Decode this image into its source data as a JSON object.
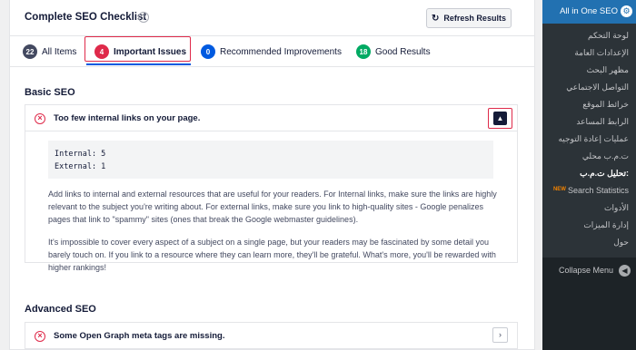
{
  "header": {
    "title": "Complete SEO Checklist",
    "help_icon": "?",
    "refresh_label": "Refresh Results",
    "refresh_icon": "↻"
  },
  "tabs": [
    {
      "count": "22",
      "label": "All Items",
      "color": "#434960"
    },
    {
      "count": "4",
      "label": "Important Issues",
      "color": "#df2a4a"
    },
    {
      "count": "0",
      "label": "Recommended Improvements",
      "color": "#005ae0"
    },
    {
      "count": "18",
      "label": "Good Results",
      "color": "#00aa63"
    }
  ],
  "basic": {
    "section_title": "Basic SEO",
    "item_title": "Too few internal links on your page.",
    "code_line1": "Internal: 5",
    "code_line2": "External: 1",
    "para1": "Add links to internal and external resources that are useful for your readers. For Internal links, make sure the links are highly relevant to the subject you're writing about. For external links, make sure you link to high-quality sites - Google penalizes pages that link to \"spammy\" sites (ones that break the Google webmaster guidelines).",
    "para2": "It's impossible to cover every aspect of a subject on a single page, but your readers may be fascinated by some detail you barely touch on. If you link to a resource where they can learn more, they'll be grateful. What's more, you'll be rewarded with higher rankings!"
  },
  "advanced": {
    "section_title": "Advanced SEO",
    "item_title": "Some Open Graph meta tags are missing."
  },
  "sidebar": {
    "top_label": "All in One SEO",
    "items": [
      "لوحة التحكم",
      "الإعدادات العامة",
      "مظهر البحث",
      "التواصل الاجتماعي",
      "خرائط الموقع",
      "الرابط المساعد",
      "عمليات إعادة التوجيه",
      "ت.م.ب محلي",
      "تحليل ت.م.ب:",
      "Search Statistics",
      "الأدوات",
      "إدارة الميزات",
      "حول"
    ],
    "new_badge": "NEW",
    "collapse_label": "Collapse Menu"
  },
  "colors": {
    "accent_blue": "#005ae0",
    "error_red": "#df2a4a",
    "success_green": "#00aa63",
    "wp_sidebar": "#1d2327",
    "wp_active": "#2271b1"
  }
}
